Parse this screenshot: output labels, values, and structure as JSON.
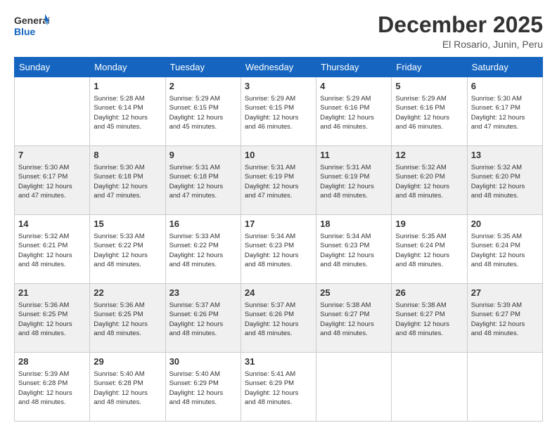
{
  "header": {
    "logo_line1": "General",
    "logo_line2": "Blue",
    "title": "December 2025",
    "subtitle": "El Rosario, Junin, Peru"
  },
  "calendar": {
    "days_of_week": [
      "Sunday",
      "Monday",
      "Tuesday",
      "Wednesday",
      "Thursday",
      "Friday",
      "Saturday"
    ],
    "weeks": [
      [
        {
          "day": "",
          "info": ""
        },
        {
          "day": "1",
          "info": "Sunrise: 5:28 AM\nSunset: 6:14 PM\nDaylight: 12 hours\nand 45 minutes."
        },
        {
          "day": "2",
          "info": "Sunrise: 5:29 AM\nSunset: 6:15 PM\nDaylight: 12 hours\nand 45 minutes."
        },
        {
          "day": "3",
          "info": "Sunrise: 5:29 AM\nSunset: 6:15 PM\nDaylight: 12 hours\nand 46 minutes."
        },
        {
          "day": "4",
          "info": "Sunrise: 5:29 AM\nSunset: 6:16 PM\nDaylight: 12 hours\nand 46 minutes."
        },
        {
          "day": "5",
          "info": "Sunrise: 5:29 AM\nSunset: 6:16 PM\nDaylight: 12 hours\nand 46 minutes."
        },
        {
          "day": "6",
          "info": "Sunrise: 5:30 AM\nSunset: 6:17 PM\nDaylight: 12 hours\nand 47 minutes."
        }
      ],
      [
        {
          "day": "7",
          "info": "Sunrise: 5:30 AM\nSunset: 6:17 PM\nDaylight: 12 hours\nand 47 minutes."
        },
        {
          "day": "8",
          "info": "Sunrise: 5:30 AM\nSunset: 6:18 PM\nDaylight: 12 hours\nand 47 minutes."
        },
        {
          "day": "9",
          "info": "Sunrise: 5:31 AM\nSunset: 6:18 PM\nDaylight: 12 hours\nand 47 minutes."
        },
        {
          "day": "10",
          "info": "Sunrise: 5:31 AM\nSunset: 6:19 PM\nDaylight: 12 hours\nand 47 minutes."
        },
        {
          "day": "11",
          "info": "Sunrise: 5:31 AM\nSunset: 6:19 PM\nDaylight: 12 hours\nand 48 minutes."
        },
        {
          "day": "12",
          "info": "Sunrise: 5:32 AM\nSunset: 6:20 PM\nDaylight: 12 hours\nand 48 minutes."
        },
        {
          "day": "13",
          "info": "Sunrise: 5:32 AM\nSunset: 6:20 PM\nDaylight: 12 hours\nand 48 minutes."
        }
      ],
      [
        {
          "day": "14",
          "info": "Sunrise: 5:32 AM\nSunset: 6:21 PM\nDaylight: 12 hours\nand 48 minutes."
        },
        {
          "day": "15",
          "info": "Sunrise: 5:33 AM\nSunset: 6:22 PM\nDaylight: 12 hours\nand 48 minutes."
        },
        {
          "day": "16",
          "info": "Sunrise: 5:33 AM\nSunset: 6:22 PM\nDaylight: 12 hours\nand 48 minutes."
        },
        {
          "day": "17",
          "info": "Sunrise: 5:34 AM\nSunset: 6:23 PM\nDaylight: 12 hours\nand 48 minutes."
        },
        {
          "day": "18",
          "info": "Sunrise: 5:34 AM\nSunset: 6:23 PM\nDaylight: 12 hours\nand 48 minutes."
        },
        {
          "day": "19",
          "info": "Sunrise: 5:35 AM\nSunset: 6:24 PM\nDaylight: 12 hours\nand 48 minutes."
        },
        {
          "day": "20",
          "info": "Sunrise: 5:35 AM\nSunset: 6:24 PM\nDaylight: 12 hours\nand 48 minutes."
        }
      ],
      [
        {
          "day": "21",
          "info": "Sunrise: 5:36 AM\nSunset: 6:25 PM\nDaylight: 12 hours\nand 48 minutes."
        },
        {
          "day": "22",
          "info": "Sunrise: 5:36 AM\nSunset: 6:25 PM\nDaylight: 12 hours\nand 48 minutes."
        },
        {
          "day": "23",
          "info": "Sunrise: 5:37 AM\nSunset: 6:26 PM\nDaylight: 12 hours\nand 48 minutes."
        },
        {
          "day": "24",
          "info": "Sunrise: 5:37 AM\nSunset: 6:26 PM\nDaylight: 12 hours\nand 48 minutes."
        },
        {
          "day": "25",
          "info": "Sunrise: 5:38 AM\nSunset: 6:27 PM\nDaylight: 12 hours\nand 48 minutes."
        },
        {
          "day": "26",
          "info": "Sunrise: 5:38 AM\nSunset: 6:27 PM\nDaylight: 12 hours\nand 48 minutes."
        },
        {
          "day": "27",
          "info": "Sunrise: 5:39 AM\nSunset: 6:27 PM\nDaylight: 12 hours\nand 48 minutes."
        }
      ],
      [
        {
          "day": "28",
          "info": "Sunrise: 5:39 AM\nSunset: 6:28 PM\nDaylight: 12 hours\nand 48 minutes."
        },
        {
          "day": "29",
          "info": "Sunrise: 5:40 AM\nSunset: 6:28 PM\nDaylight: 12 hours\nand 48 minutes."
        },
        {
          "day": "30",
          "info": "Sunrise: 5:40 AM\nSunset: 6:29 PM\nDaylight: 12 hours\nand 48 minutes."
        },
        {
          "day": "31",
          "info": "Sunrise: 5:41 AM\nSunset: 6:29 PM\nDaylight: 12 hours\nand 48 minutes."
        },
        {
          "day": "",
          "info": ""
        },
        {
          "day": "",
          "info": ""
        },
        {
          "day": "",
          "info": ""
        }
      ]
    ]
  }
}
